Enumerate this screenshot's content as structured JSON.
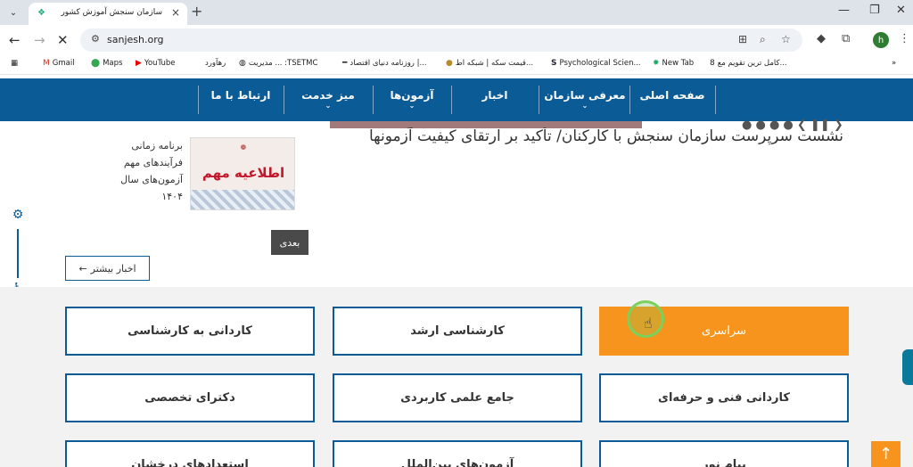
{
  "browser": {
    "tab_title": "سازمان سنجش آموزش کشور",
    "url": "sanjesh.org",
    "avatar_letter": "h"
  },
  "bookmarks": [
    {
      "label": "Gmail",
      "icon": "gmail-icon"
    },
    {
      "label": "Maps",
      "icon": "maps-icon"
    },
    {
      "label": "YouTube",
      "icon": "youtube-icon"
    },
    {
      "label": "رهآورد",
      "icon": "globe-icon"
    },
    {
      "label": "مدیریت ... :TSETMC",
      "icon": "globe-icon"
    },
    {
      "label": "روزنامه دنیای اقتصاد |...",
      "icon": "dash-icon"
    },
    {
      "label": "قیمت سکه | شبکه اط...",
      "icon": "coin-icon"
    },
    {
      "label": "Psychological Scien...",
      "icon": "s-icon"
    },
    {
      "label": "New Tab",
      "icon": "sun-icon"
    },
    {
      "label": "کامل ترین تقویم مع...",
      "icon": "calendar-icon"
    }
  ],
  "nav": {
    "items": [
      {
        "label": "صفحه اصلی",
        "dropdown": false
      },
      {
        "label": "معرفی سازمان",
        "dropdown": true
      },
      {
        "label": "اخبار",
        "dropdown": false
      },
      {
        "label": "آزمون‌ها",
        "dropdown": true
      },
      {
        "label": "میز خدمت",
        "dropdown": true
      },
      {
        "label": "ارتباط با ما",
        "dropdown": false
      }
    ]
  },
  "news": {
    "headline": "نشست سرپرست سازمان سنجش با کارکنان/ تأکید بر ارتقای کیفیت آزمونها",
    "side_text": "برنامه زمانی فرآیندهای مهم آزمون‌های سال ۱۴۰۴",
    "notice_title": "اطلاعیه مهم",
    "next_label": "بعدی",
    "more_label": "اخبار بیشتر"
  },
  "exam_cards": [
    {
      "label": "سراسری",
      "active": true
    },
    {
      "label": "کارشناسی ارشد",
      "active": false
    },
    {
      "label": "کاردانی به کارشناسی",
      "active": false
    },
    {
      "label": "کاردانی فنی و حرفه‌ای",
      "active": false
    },
    {
      "label": "جامع علمی کاربردی",
      "active": false
    },
    {
      "label": "دکترای تخصصی",
      "active": false
    },
    {
      "label": "پیام نور",
      "active": false
    },
    {
      "label": "آزمون‌های بین‌الملل",
      "active": false
    },
    {
      "label": "استعدادهای درخشان",
      "active": false
    }
  ],
  "colors": {
    "brand_blue": "#0b5b96",
    "accent_orange": "#f7941d"
  }
}
